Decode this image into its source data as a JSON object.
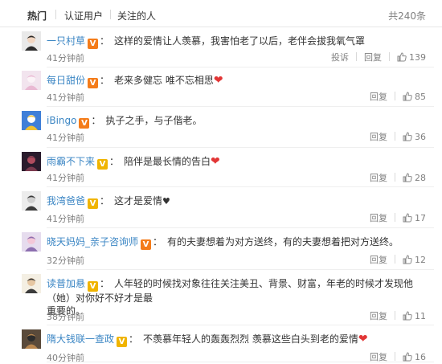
{
  "tabs": [
    {
      "label": "热门",
      "active": true
    },
    {
      "label": "认证用户",
      "active": false
    },
    {
      "label": "关注的人",
      "active": false
    }
  ],
  "total": "共240条",
  "labels": {
    "report": "投诉",
    "reply": "回复"
  },
  "colors": {
    "username": "#3b86c4",
    "heart": "#e23636",
    "badge_orange": "#f47c1a",
    "badge_gold": "#f0b400"
  },
  "comments": [
    {
      "user": "一只村草",
      "badge": "V",
      "text": "这样的爱情让人羡慕，我害怕老了以后，老伴会拔我氧气罩",
      "time": "41分钟前",
      "report": true,
      "likes": "139"
    },
    {
      "user": "每日甜份",
      "badge": "V",
      "text": "老来多健忘 唯不忘相思",
      "heart": true,
      "time": "41分钟前",
      "likes": "85"
    },
    {
      "user": "iBingo",
      "badge": "V",
      "text": "执子之手，与子偕老。",
      "time": "41分钟前",
      "likes": "36"
    },
    {
      "user": "雨霸不下来",
      "badge": "V",
      "text": "陪伴是最长情的告白",
      "heart": true,
      "time": "41分钟前",
      "likes": "28"
    },
    {
      "user": "我湾爸爸",
      "badge": "V",
      "text": "这才是爱情",
      "heart_dark": true,
      "time": "41分钟前",
      "likes": "17"
    },
    {
      "user": "晓天妈妈_亲子咨询师",
      "badge": "V",
      "text": "有的夫妻想着为对方送终，有的夫妻想着把对方送终。",
      "time": "32分钟前",
      "likes": "12"
    },
    {
      "user": "读普加悬",
      "badge": "V",
      "text": "人年轻的时候找对象往往关注美丑、背景、财富，年老的时候才发现他（她）对你好不好才是最",
      "text2": "重要的。",
      "time": "38分钟前",
      "likes": "11"
    },
    {
      "user": "隋大钱联一查政",
      "badge": "V",
      "text": "不羡慕年轻人的轰轰烈烈 羡慕这些白头到老的爱情",
      "heart": true,
      "time": "40分钟前",
      "likes": "16"
    }
  ]
}
